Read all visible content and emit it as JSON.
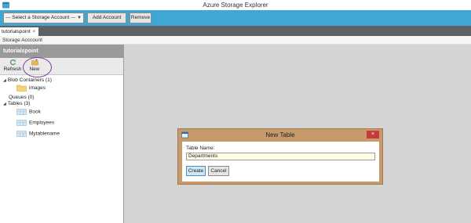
{
  "window": {
    "title": "Azure Storage Explorer"
  },
  "toolbar": {
    "account_select": "--- Select a Storage Account ---",
    "add_account_label": "Add Account",
    "remove_label": "Remove"
  },
  "tabs": [
    {
      "label": "tutorialspoint",
      "close": "×"
    }
  ],
  "section": {
    "label": "Storage Acccount"
  },
  "panel": {
    "header": "tutorialspoint",
    "refresh_label": "Refresh",
    "new_label": "New"
  },
  "tree": {
    "blob_containers": "Blob Containers (1)",
    "blob_items": [
      "images"
    ],
    "queues": "Queues (0)",
    "tables": "Tables (3)",
    "table_items": [
      "Book",
      "Employees",
      "Mytablename"
    ]
  },
  "dialog": {
    "title": "New Table",
    "close": "×",
    "table_name_label": "Table Name:",
    "table_name_value": "Departments",
    "create_label": "Create",
    "cancel_label": "Cancel"
  },
  "colors": {
    "toolbar": "#3ea7d4",
    "dialog_frame": "#c79a6b",
    "dialog_close": "#c63a3a",
    "highlight_ring": "#7b3a9a"
  },
  "icons": [
    "app-icon",
    "chevron-down-icon",
    "refresh-icon",
    "new-folder-icon",
    "folder-icon",
    "table-icon",
    "expand-triangle-icon",
    "close-icon"
  ]
}
